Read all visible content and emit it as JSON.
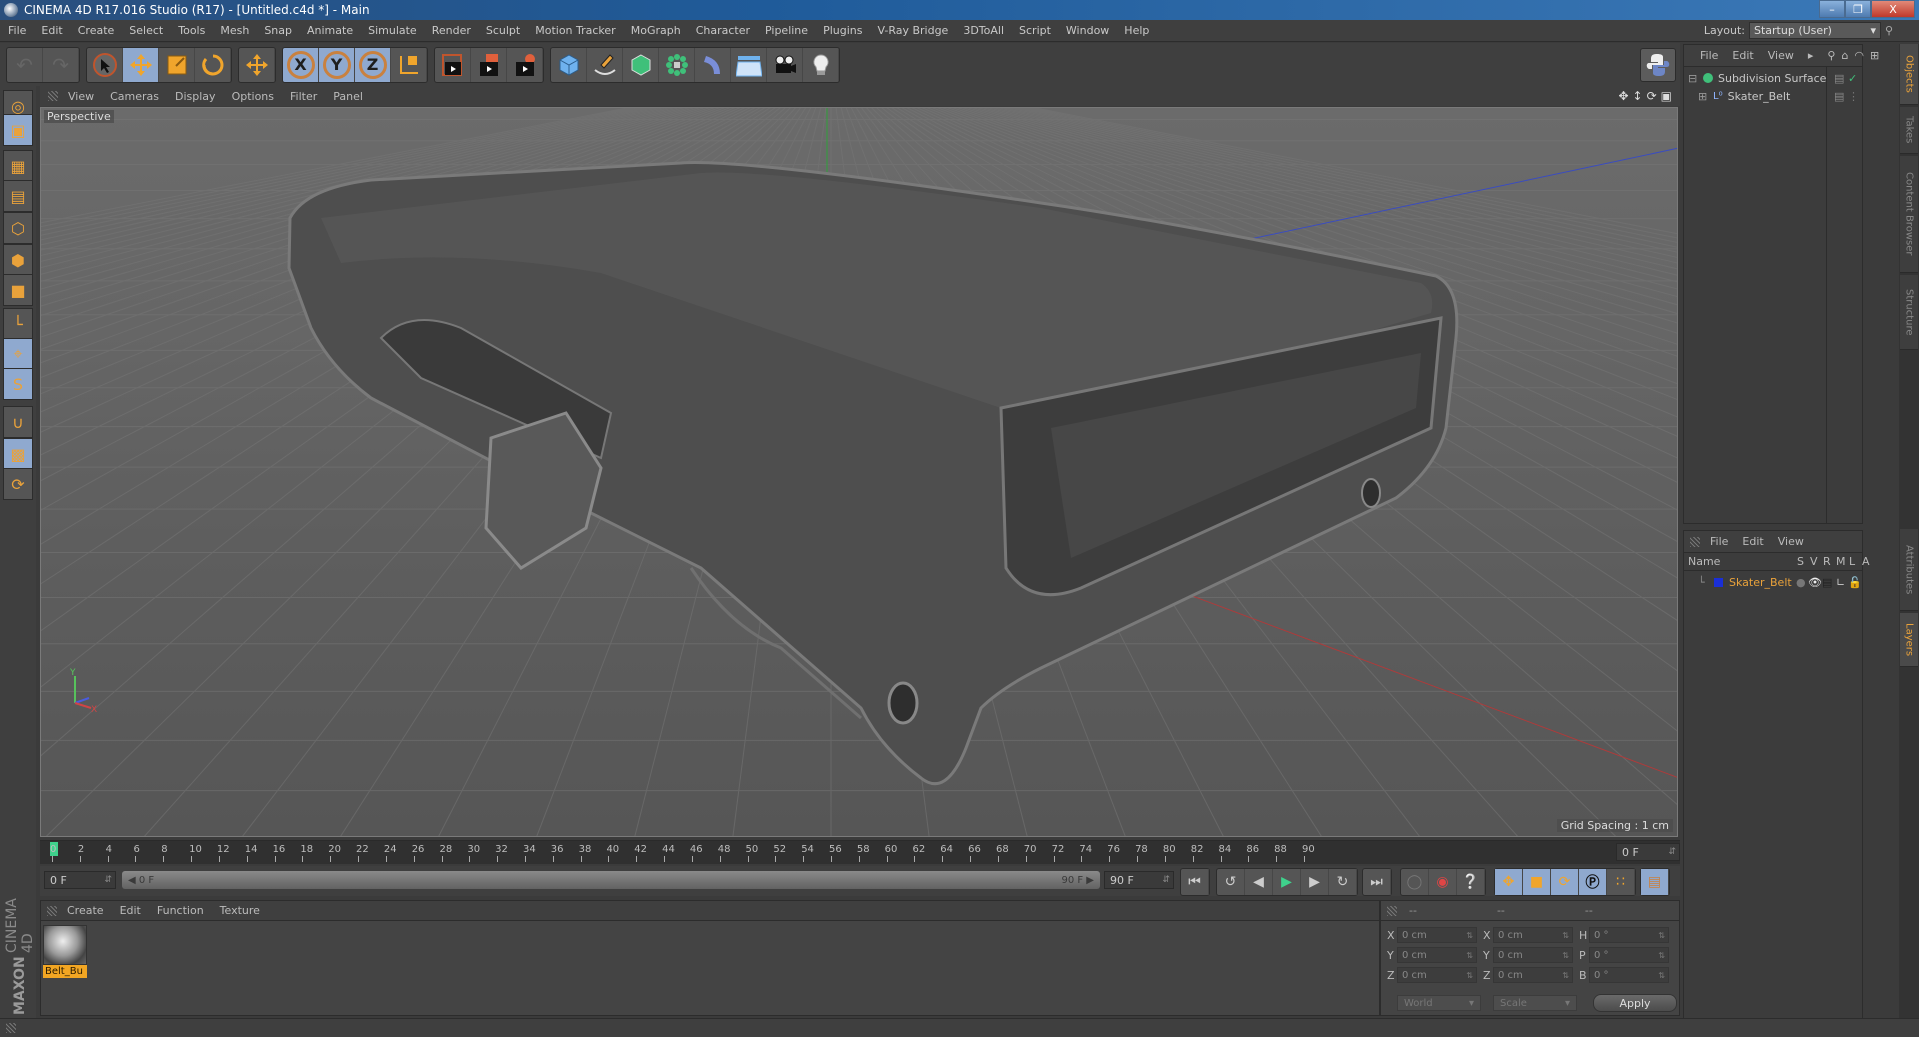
{
  "window": {
    "title": "CINEMA 4D R17.016 Studio (R17) - [Untitled.c4d *] - Main",
    "controls": [
      "minimize",
      "restore",
      "close"
    ]
  },
  "menu": {
    "items": [
      "File",
      "Edit",
      "Create",
      "Select",
      "Tools",
      "Mesh",
      "Snap",
      "Animate",
      "Simulate",
      "Render",
      "Sculpt",
      "Motion Tracker",
      "MoGraph",
      "Character",
      "Pipeline",
      "Plugins",
      "V-Ray Bridge",
      "3DToAll",
      "Script",
      "Window",
      "Help"
    ],
    "layout_label": "Layout:",
    "layout_value": "Startup (User)"
  },
  "toolbar": {
    "groups": [
      {
        "name": "undo-redo",
        "buttons": [
          {
            "icon": "undo-icon",
            "active": false,
            "disabled": true
          },
          {
            "icon": "redo-icon",
            "active": false,
            "disabled": true
          }
        ]
      },
      {
        "name": "transform",
        "buttons": [
          {
            "icon": "select-arrow-icon",
            "active": false
          },
          {
            "icon": "move-icon",
            "active": true
          },
          {
            "icon": "scale-icon",
            "active": false
          },
          {
            "icon": "rotate-icon",
            "active": false
          }
        ]
      },
      {
        "name": "recent",
        "buttons": [
          {
            "icon": "live-selection-move-icon",
            "active": false
          }
        ]
      },
      {
        "name": "axis-lock",
        "buttons": [
          {
            "icon": "x-axis-icon",
            "label": "X",
            "active": true
          },
          {
            "icon": "y-axis-icon",
            "label": "Y",
            "active": true
          },
          {
            "icon": "z-axis-icon",
            "label": "Z",
            "active": true
          },
          {
            "icon": "coordinate-system-icon",
            "active": false
          }
        ]
      },
      {
        "name": "render",
        "buttons": [
          {
            "icon": "render-view-icon",
            "active": false
          },
          {
            "icon": "render-picture-viewer-icon",
            "active": false
          },
          {
            "icon": "render-settings-icon",
            "active": false
          }
        ]
      },
      {
        "name": "create",
        "buttons": [
          {
            "icon": "cube-icon"
          },
          {
            "icon": "pen-spline-icon"
          },
          {
            "icon": "subdivision-surface-icon"
          },
          {
            "icon": "cloner-icon"
          },
          {
            "icon": "deformer-bend-icon"
          },
          {
            "icon": "floor-icon"
          },
          {
            "icon": "camera-icon"
          },
          {
            "icon": "light-icon"
          }
        ]
      }
    ],
    "python_icon": "python-icon"
  },
  "left_tools": [
    {
      "icon": "make-editable-icon",
      "active": false
    },
    {
      "icon": "model-mode-icon",
      "active": true
    },
    {
      "icon": "texture-mode-icon",
      "active": false
    },
    {
      "icon": "workplane-mode-icon",
      "active": false
    },
    {
      "icon": "points-mode-icon",
      "active": false
    },
    {
      "icon": "edges-mode-icon",
      "active": false
    },
    {
      "icon": "polygons-mode-icon",
      "active": false
    },
    {
      "icon": "axis-mode-icon",
      "active": false
    },
    {
      "icon": "tweak-mode-icon",
      "active": true
    },
    {
      "icon": "solo-mode-icon",
      "active": true
    },
    {
      "icon": "snap-magnet-icon",
      "active": false
    },
    {
      "icon": "lock-workplane-icon",
      "active": true
    },
    {
      "icon": "workplane-rotate-icon",
      "active": false
    }
  ],
  "viewport": {
    "menu": [
      "View",
      "Cameras",
      "Display",
      "Options",
      "Filter",
      "Panel"
    ],
    "label": "Perspective",
    "grid_spacing": "Grid Spacing : 1 cm",
    "nav_icons": [
      "move-view-icon",
      "dolly-view-icon",
      "rotate-view-icon",
      "toggle-layout-icon"
    ]
  },
  "timeline": {
    "start": 0,
    "end": 90,
    "step": 2,
    "current_frame": 0,
    "current_field": "0 F"
  },
  "transport": {
    "start_field": "0 F",
    "range_start": "0 F",
    "range_end": "90 F",
    "end_field": "90 F",
    "buttons": [
      "go-to-start-icon",
      "previous-key-icon",
      "previous-frame-icon",
      "play-icon",
      "next-frame-icon",
      "next-key-icon",
      "go-to-end-icon"
    ],
    "record_buttons": [
      "motion-record-icon",
      "record-active-objects-icon",
      "autokeying-icon"
    ],
    "key_buttons": [
      "key-position-icon",
      "key-scale-icon",
      "key-rotation-icon",
      "key-parameter-icon",
      "key-point-level-icon"
    ],
    "timeline_button": "timeline-window-icon"
  },
  "materials": {
    "menu": [
      "Create",
      "Edit",
      "Function",
      "Texture"
    ],
    "items": [
      {
        "name": "Belt_Bu"
      }
    ]
  },
  "brand": {
    "maxon": "MAXON",
    "product": "CINEMA 4D"
  },
  "coordinates": {
    "headers": [
      "--",
      "--",
      "--"
    ],
    "rows": [
      {
        "l1": "X",
        "v1": "0 cm",
        "l2": "X",
        "v2": "0 cm",
        "l3": "H",
        "v3": "0 °"
      },
      {
        "l1": "Y",
        "v1": "0 cm",
        "l2": "Y",
        "v2": "0 cm",
        "l3": "P",
        "v3": "0 °"
      },
      {
        "l1": "Z",
        "v1": "0 cm",
        "l2": "Z",
        "v2": "0 cm",
        "l3": "B",
        "v3": "0 °"
      }
    ],
    "space": "World",
    "mode": "Scale",
    "apply_label": "Apply"
  },
  "objects_panel": {
    "menu": [
      "File",
      "Edit",
      "View"
    ],
    "items": [
      {
        "name": "Subdivision Surface",
        "icon": "subdivision-surface-icon",
        "level": 0,
        "expanded": true,
        "enabled": true
      },
      {
        "name": "Skater_Belt",
        "icon": "null-object-icon",
        "level": 1,
        "expanded": false
      }
    ]
  },
  "layers_panel": {
    "menu": [
      "File",
      "Edit",
      "View"
    ],
    "columns": [
      "Name",
      "S",
      "V",
      "R",
      "M",
      "L",
      "A"
    ],
    "items": [
      {
        "name": "Skater_Belt",
        "color": "#1a2fd8"
      }
    ]
  },
  "side_tabs": {
    "top": [
      {
        "label": "Objects",
        "active": true
      },
      {
        "label": "Takes",
        "active": false
      },
      {
        "label": "Content Browser",
        "active": false
      },
      {
        "label": "Structure",
        "active": false
      }
    ],
    "bottom": [
      {
        "label": "Attributes",
        "active": false
      },
      {
        "label": "Layers",
        "active": true
      }
    ]
  },
  "colors": {
    "accent": "#e9a23b",
    "active_button": "#8fa9cf",
    "material_label": "#f2a623",
    "timeline_cursor": "#3fd18c",
    "layer_name": "#e9a23b"
  }
}
